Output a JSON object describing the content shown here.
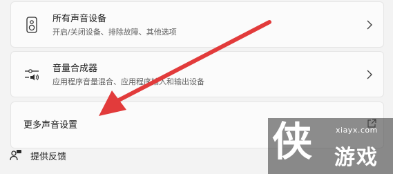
{
  "settings": {
    "all_devices": {
      "title": "所有声音设备",
      "subtitle": "开启/关闭设备、排除故障、其他选项",
      "icon": "speaker-icon"
    },
    "volume_mixer": {
      "title": "音量合成器",
      "subtitle": "应用程序音量混合、应用程序输入和输出设备",
      "icon": "mixer-slider-icon"
    },
    "more_settings": {
      "title": "更多声音设置",
      "icon": "external-link-icon"
    }
  },
  "feedback": {
    "label": "提供反馈",
    "icon": "feedback-person-icon"
  },
  "annotation": {
    "arrow_color": "#e23b3b"
  },
  "watermark": {
    "glyph": "侠",
    "site": "xiayx.com",
    "brand": "游戏"
  }
}
